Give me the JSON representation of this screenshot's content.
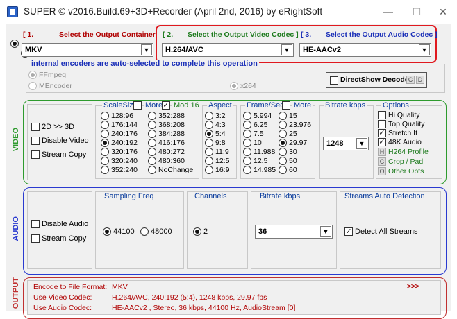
{
  "window": {
    "title": "SUPER © v2016.Build.69+3D+Recorder (April 2nd, 2016) by eRightSoft",
    "minimize": "—",
    "maximize": "☐",
    "close": "✕"
  },
  "step1": {
    "number": "[ 1.",
    "label": "Select the Output Container",
    "value": "MKV"
  },
  "step2": {
    "number": "[ 2.",
    "label": "Select the Output Video Codec ]",
    "value": "H.264/AVC"
  },
  "step3": {
    "number": "[ 3.",
    "label": "Select the Output Audio Codec ]",
    "value": "HE-AACv2"
  },
  "encoders": {
    "notice": "internal encoders are auto-selected to complete this operation",
    "ffmpeg": "FFmpeg",
    "mencoder": "MEncoder",
    "x264": "x264",
    "directshow": "DirectShow Decode",
    "c_btn": "C",
    "d_btn": "D"
  },
  "video": {
    "side_label": "VIDEO",
    "mode_2d3d": "2D >> 3D",
    "disable": "Disable Video",
    "stream_copy": "Stream Copy",
    "scalesize": {
      "title": "ScaleSize",
      "more": "More",
      "mod16": "Mod 16",
      "col1": [
        "128:96",
        "176:144",
        "240:176",
        "240:192",
        "320:176",
        "320:240",
        "352:240"
      ],
      "col2": [
        "352:288",
        "368:208",
        "384:288",
        "416:176",
        "480:272",
        "480:360",
        "NoChange"
      ],
      "selected": "240:192"
    },
    "aspect": {
      "title": "Aspect",
      "items": [
        "3:2",
        "4:3",
        "5:4",
        "9:8",
        "11:9",
        "12:5",
        "16:9"
      ],
      "selected": "5:4"
    },
    "framesec": {
      "title": "Frame/Sec",
      "more": "More",
      "col1": [
        "5.994",
        "6.25",
        "7.5",
        "10",
        "11.988",
        "12.5",
        "14.985"
      ],
      "col2": [
        "15",
        "23.976",
        "25",
        "29.97",
        "30",
        "50",
        "60"
      ],
      "selected": "29.97"
    },
    "bitrate": {
      "title": "Bitrate  kbps",
      "value": "1248"
    },
    "options": {
      "title": "Options",
      "hi_quality": "Hi Quality",
      "top_quality": "Top Quality",
      "stretch_it": "Stretch It",
      "audio48k": "48K Audio",
      "h264_profile_btn": "H",
      "h264_profile": "H264 Profile",
      "crop_pad_btn": "C",
      "crop_pad": "Crop / Pad",
      "other_opts_btn": "O",
      "other_opts": "Other Opts"
    }
  },
  "audio": {
    "side_label": "AUDIO",
    "disable": "Disable Audio",
    "stream_copy": "Stream Copy",
    "sampling": {
      "title": "Sampling Freq",
      "options": [
        "44100",
        "48000"
      ],
      "selected": "44100"
    },
    "channels": {
      "title": "Channels",
      "value": "2"
    },
    "bitrate": {
      "title": "Bitrate  kbps",
      "value": "36"
    },
    "streams": {
      "title": "Streams Auto Detection",
      "detect_all": "Detect All Streams"
    }
  },
  "output": {
    "side_label": "OUTPUT",
    "rows": [
      {
        "label": "Encode to File Format:",
        "value": "MKV"
      },
      {
        "label": "Use Video Codec:",
        "value": "H.264/AVC,  240:192 (5:4),  1248 kbps,  29.97 fps"
      },
      {
        "label": "Use Audio Codec:",
        "value": "HE-AACv2 , Stereo,  36 kbps,  44100 Hz,  AudioStream [0]"
      }
    ],
    "more": ">>>"
  },
  "colors": {
    "step1": "#b00000",
    "step2": "#1c7a1c",
    "step3": "#1a2fb8",
    "highlight": "#e0191f",
    "video_border": "#2e9b2e",
    "audio_border": "#2a3ad0",
    "output_border": "#c03030"
  }
}
